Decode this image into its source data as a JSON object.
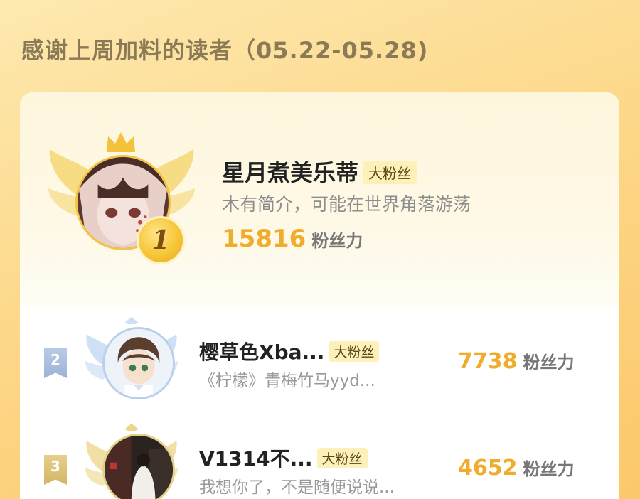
{
  "header": {
    "title": "感谢上周加料的读者（05.22-05.28)"
  },
  "top_reader": {
    "rank": "1",
    "name": "星月煮美乐蒂",
    "badge": "大粉丝",
    "bio": "木有简介，可能在世界角落游荡",
    "score": "15816",
    "score_unit": "粉丝力"
  },
  "readers": [
    {
      "rank": "2",
      "name": "樱草色Xba...",
      "badge": "大粉丝",
      "bio": "《柠檬》青梅竹马yyd...",
      "score": "7738",
      "score_unit": "粉丝力"
    },
    {
      "rank": "3",
      "name": "V1314不...",
      "badge": "大粉丝",
      "bio": "我想你了，不是随便说说...",
      "score": "4652",
      "score_unit": "粉丝力"
    }
  ],
  "colors": {
    "accent_score": "#f0ac2c",
    "badge_bg": "#fdf0b8",
    "gold": "#f5c443"
  }
}
